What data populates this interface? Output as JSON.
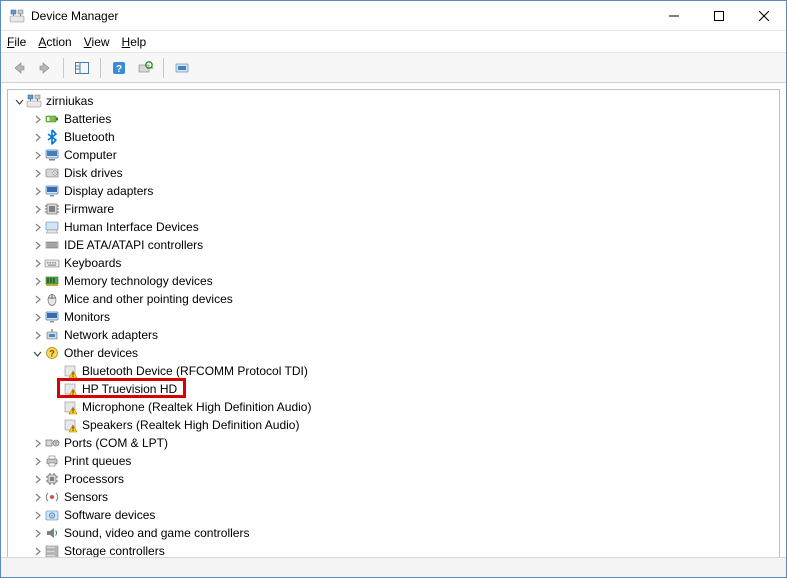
{
  "window": {
    "title": "Device Manager"
  },
  "menu": {
    "file": "File",
    "action": "Action",
    "view": "View",
    "help": "Help"
  },
  "tree": {
    "root": {
      "label": "zirniukas",
      "expanded": true
    },
    "nodes": [
      {
        "label": "Batteries",
        "icon": "battery",
        "expanded": false
      },
      {
        "label": "Bluetooth",
        "icon": "bluetooth",
        "expanded": false
      },
      {
        "label": "Computer",
        "icon": "computer",
        "expanded": false
      },
      {
        "label": "Disk drives",
        "icon": "disk",
        "expanded": false
      },
      {
        "label": "Display adapters",
        "icon": "display",
        "expanded": false
      },
      {
        "label": "Firmware",
        "icon": "firmware",
        "expanded": false
      },
      {
        "label": "Human Interface Devices",
        "icon": "hid",
        "expanded": false
      },
      {
        "label": "IDE ATA/ATAPI controllers",
        "icon": "ide",
        "expanded": false
      },
      {
        "label": "Keyboards",
        "icon": "keyboard",
        "expanded": false
      },
      {
        "label": "Memory technology devices",
        "icon": "memory",
        "expanded": false
      },
      {
        "label": "Mice and other pointing devices",
        "icon": "mouse",
        "expanded": false
      },
      {
        "label": "Monitors",
        "icon": "monitor",
        "expanded": false
      },
      {
        "label": "Network adapters",
        "icon": "network",
        "expanded": false
      },
      {
        "label": "Other devices",
        "icon": "other",
        "expanded": true,
        "children": [
          {
            "label": "Bluetooth Device (RFCOMM Protocol TDI)",
            "icon": "warn"
          },
          {
            "label": "HP Truevision HD",
            "icon": "warn",
            "highlighted": true
          },
          {
            "label": "Microphone (Realtek High Definition Audio)",
            "icon": "warn"
          },
          {
            "label": "Speakers (Realtek High Definition Audio)",
            "icon": "warn"
          }
        ]
      },
      {
        "label": "Ports (COM & LPT)",
        "icon": "ports",
        "expanded": false
      },
      {
        "label": "Print queues",
        "icon": "print",
        "expanded": false
      },
      {
        "label": "Processors",
        "icon": "processor",
        "expanded": false
      },
      {
        "label": "Sensors",
        "icon": "sensor",
        "expanded": false
      },
      {
        "label": "Software devices",
        "icon": "software",
        "expanded": false
      },
      {
        "label": "Sound, video and game controllers",
        "icon": "sound",
        "expanded": false
      },
      {
        "label": "Storage controllers",
        "icon": "storage",
        "expanded": false
      }
    ]
  },
  "colors": {
    "highlight": "#d80000",
    "bluetooth": "#0078d7"
  }
}
